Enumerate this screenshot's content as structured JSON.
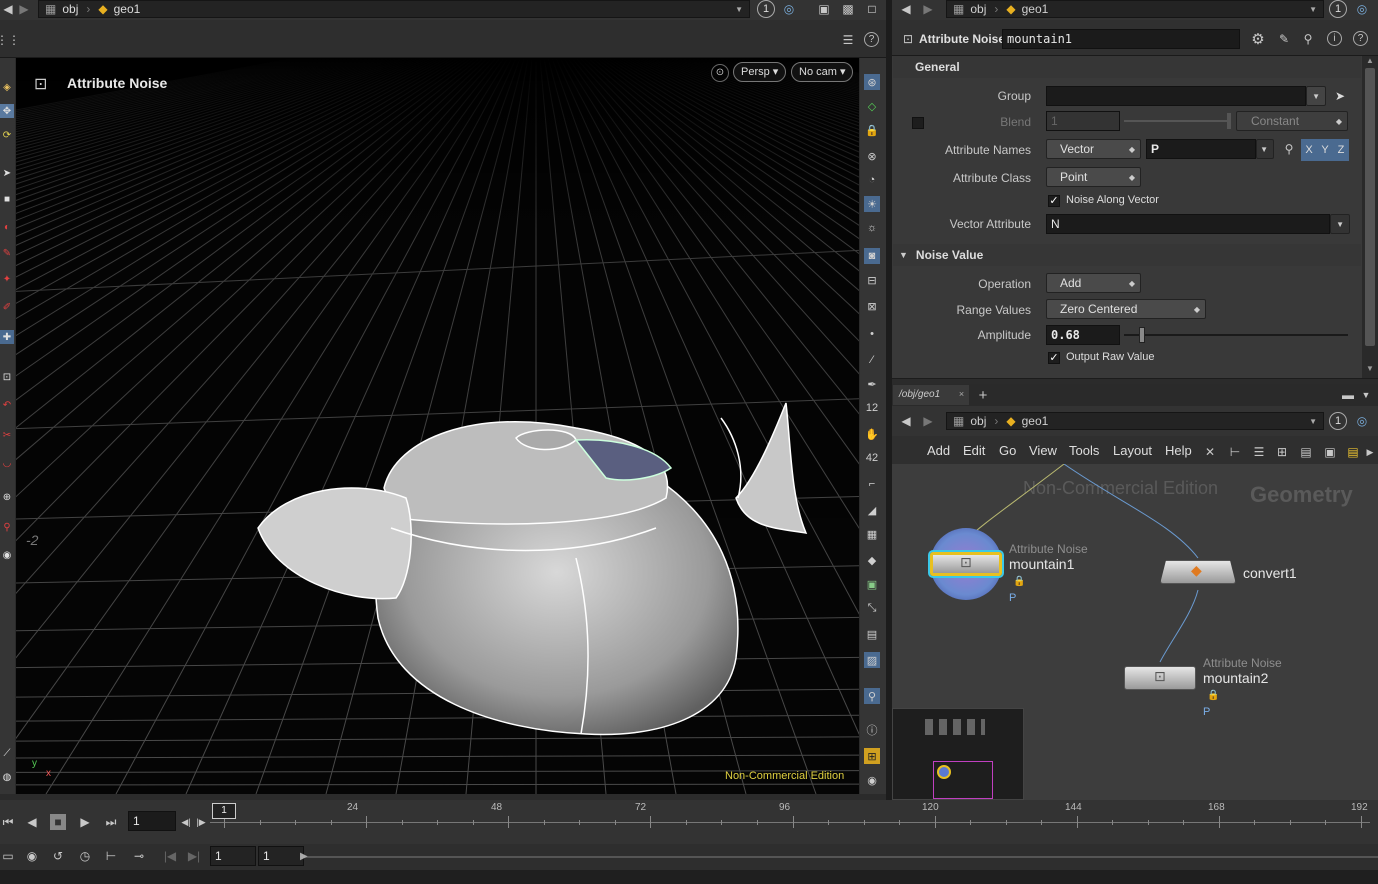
{
  "left_pane": {
    "path": {
      "root": "obj",
      "node": "geo1"
    },
    "view_indicator": "1",
    "viewport": {
      "state_title": "Attribute Noise",
      "camera_mode": "Persp",
      "camera": "No cam",
      "grid_label": "-2",
      "watermark": "Non-Commercial Edition",
      "axis_y": "y",
      "axis_x": "x"
    }
  },
  "param_pane": {
    "path": {
      "root": "obj",
      "node": "geo1"
    },
    "view_indicator": "1",
    "node_type": "Attribute Noise",
    "node_name": "mountain1",
    "sections": {
      "general": "General",
      "noise_value": "Noise Value"
    },
    "params": {
      "group": {
        "label": "Group",
        "value": ""
      },
      "blend": {
        "label": "Blend",
        "value": "1",
        "mode": "Constant"
      },
      "attribute_names": {
        "label": "Attribute Names",
        "type": "Vector",
        "value": "P",
        "comps": [
          "X",
          "Y",
          "Z"
        ]
      },
      "attribute_class": {
        "label": "Attribute Class",
        "value": "Point"
      },
      "noise_along_vector": {
        "label": "Noise Along Vector",
        "checked": true
      },
      "vector_attribute": {
        "label": "Vector Attribute",
        "value": "N"
      },
      "operation": {
        "label": "Operation",
        "value": "Add"
      },
      "range_values": {
        "label": "Range Values",
        "value": "Zero Centered"
      },
      "amplitude": {
        "label": "Amplitude",
        "value": "0.68",
        "fraction": 0.068
      },
      "output_raw_value": {
        "label": "Output Raw Value",
        "checked": true
      }
    }
  },
  "network_pane": {
    "tab_label": "/obj/geo1",
    "path": {
      "root": "obj",
      "node": "geo1"
    },
    "view_indicator": "1",
    "menu": [
      "Add",
      "Edit",
      "Go",
      "View",
      "Tools",
      "Layout",
      "Help"
    ],
    "watermark": "Non-Commercial Edition",
    "context_label": "Geometry",
    "nodes": {
      "mountain1": {
        "type": "Attribute Noise",
        "name": "mountain1",
        "attr": "P"
      },
      "convert1": {
        "name": "convert1"
      },
      "mountain2": {
        "type": "Attribute Noise",
        "name": "mountain2",
        "attr": "P"
      }
    }
  },
  "timeline": {
    "current_frame": "1",
    "marker": "1",
    "range_start": "1",
    "range_end": "1",
    "ticks": [
      "24",
      "48",
      "72",
      "96",
      "120",
      "144",
      "168",
      "192"
    ]
  }
}
